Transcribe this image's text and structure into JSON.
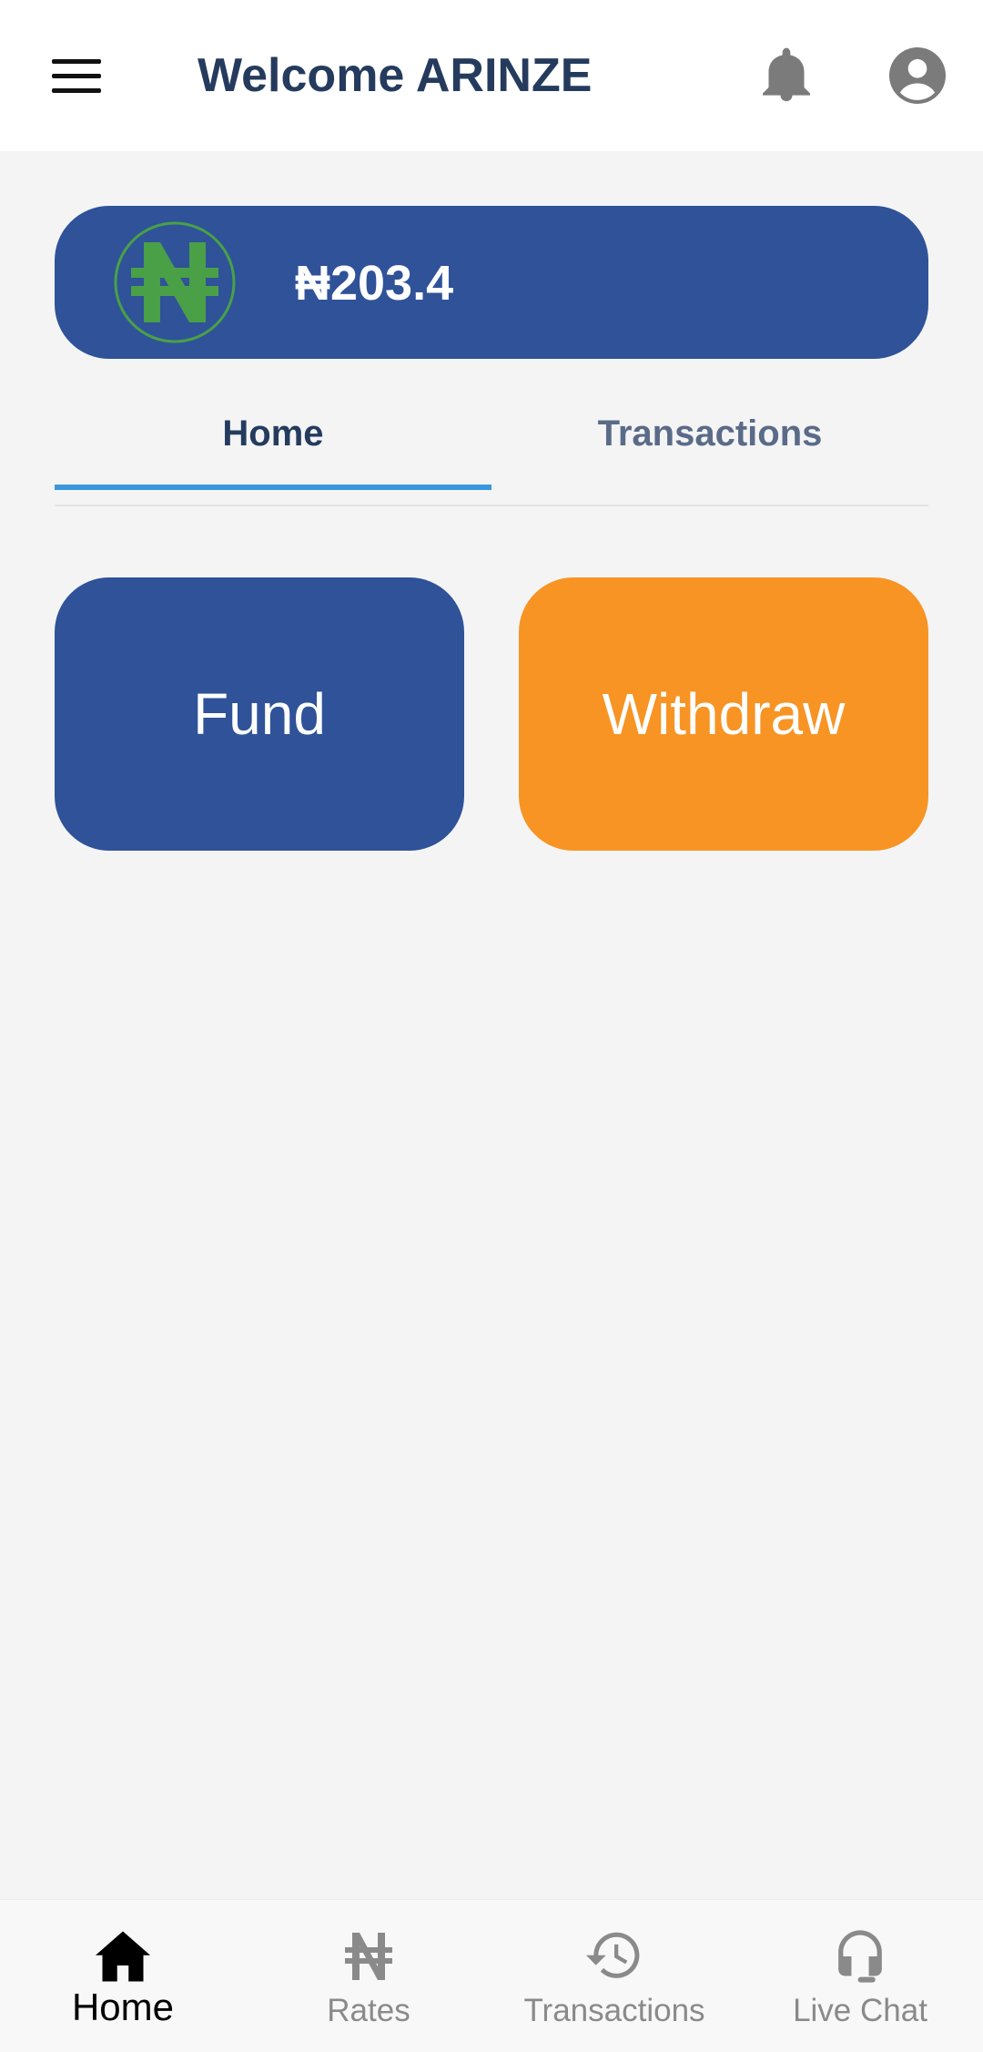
{
  "header": {
    "title": "Welcome ARINZE",
    "menu_icon": "hamburger-menu-icon",
    "notification_icon": "bell-icon",
    "profile_icon": "account-circle-icon"
  },
  "balance": {
    "currency_icon": "naira-icon",
    "amount": "₦203.4"
  },
  "tabs": [
    {
      "label": "Home",
      "active": true
    },
    {
      "label": "Transactions",
      "active": false
    }
  ],
  "actions": {
    "fund_label": "Fund",
    "withdraw_label": "Withdraw"
  },
  "bottom_nav": {
    "items": [
      {
        "label": "Home",
        "icon": "home-icon",
        "active": true
      },
      {
        "label": "Rates",
        "icon": "naira-icon",
        "active": false
      },
      {
        "label": "Transactions",
        "icon": "history-icon",
        "active": false
      },
      {
        "label": "Live Chat",
        "icon": "headset-icon",
        "active": false
      }
    ]
  },
  "colors": {
    "primary": "#2f5299",
    "accent": "#f79424",
    "title_text": "#253b5e",
    "tab_indicator": "#3a97dd",
    "naira_logo_green": "#4aa047",
    "background": "#f4f4f5"
  }
}
